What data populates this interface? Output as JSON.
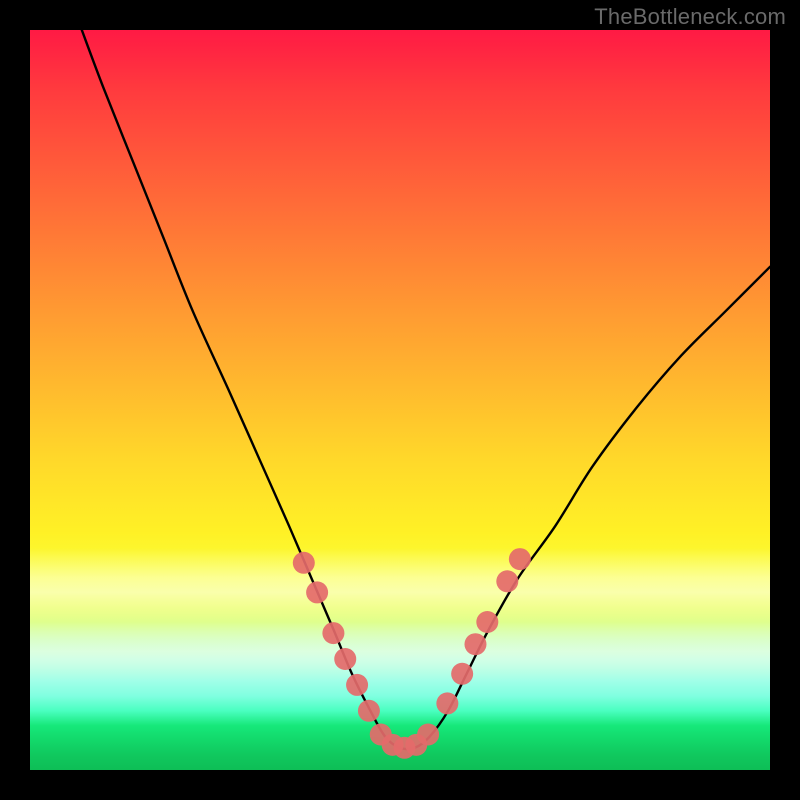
{
  "watermark": "TheBottleneck.com",
  "chart_data": {
    "type": "line",
    "title": "",
    "xlabel": "",
    "ylabel": "",
    "xlim": [
      0,
      100
    ],
    "ylim": [
      0,
      100
    ],
    "grid": false,
    "legend": false,
    "annotations": [],
    "background_gradient": {
      "top_color": "#ff1a44",
      "bottom_color": "#0ebe56",
      "description": "red-to-green vertical gradient signifying bottleneck severity (red high, green low)"
    },
    "series": [
      {
        "name": "bottleneck-curve",
        "description": "V-shaped bottleneck curve; minimum near x≈50 at y≈3",
        "x": [
          7,
          10,
          14,
          18,
          22,
          27,
          31,
          35,
          38,
          41,
          43.5,
          46,
          48,
          50,
          52,
          54,
          56.5,
          59,
          62,
          66,
          71,
          76,
          82,
          88,
          94,
          100
        ],
        "y": [
          100,
          92,
          82,
          72,
          62,
          51,
          42,
          33,
          26,
          19,
          13,
          8,
          4.5,
          3,
          3,
          4.5,
          8,
          13,
          19,
          26,
          33,
          41,
          49,
          56,
          62,
          68
        ]
      }
    ],
    "markers": [
      {
        "name": "left-cluster",
        "color": "#e46a6a",
        "radius_px": 11,
        "points": [
          {
            "x": 37.0,
            "y": 28.0
          },
          {
            "x": 38.8,
            "y": 24.0
          },
          {
            "x": 41.0,
            "y": 18.5
          },
          {
            "x": 42.6,
            "y": 15.0
          },
          {
            "x": 44.2,
            "y": 11.5
          },
          {
            "x": 45.8,
            "y": 8.0
          }
        ]
      },
      {
        "name": "bottom-cluster",
        "color": "#e46a6a",
        "radius_px": 11,
        "points": [
          {
            "x": 47.4,
            "y": 4.8
          },
          {
            "x": 49.0,
            "y": 3.4
          },
          {
            "x": 50.6,
            "y": 3.0
          },
          {
            "x": 52.2,
            "y": 3.4
          },
          {
            "x": 53.8,
            "y": 4.8
          }
        ]
      },
      {
        "name": "right-cluster",
        "color": "#e46a6a",
        "radius_px": 11,
        "points": [
          {
            "x": 56.4,
            "y": 9.0
          },
          {
            "x": 58.4,
            "y": 13.0
          },
          {
            "x": 60.2,
            "y": 17.0
          },
          {
            "x": 61.8,
            "y": 20.0
          },
          {
            "x": 64.5,
            "y": 25.5
          },
          {
            "x": 66.2,
            "y": 28.5
          }
        ]
      }
    ]
  }
}
